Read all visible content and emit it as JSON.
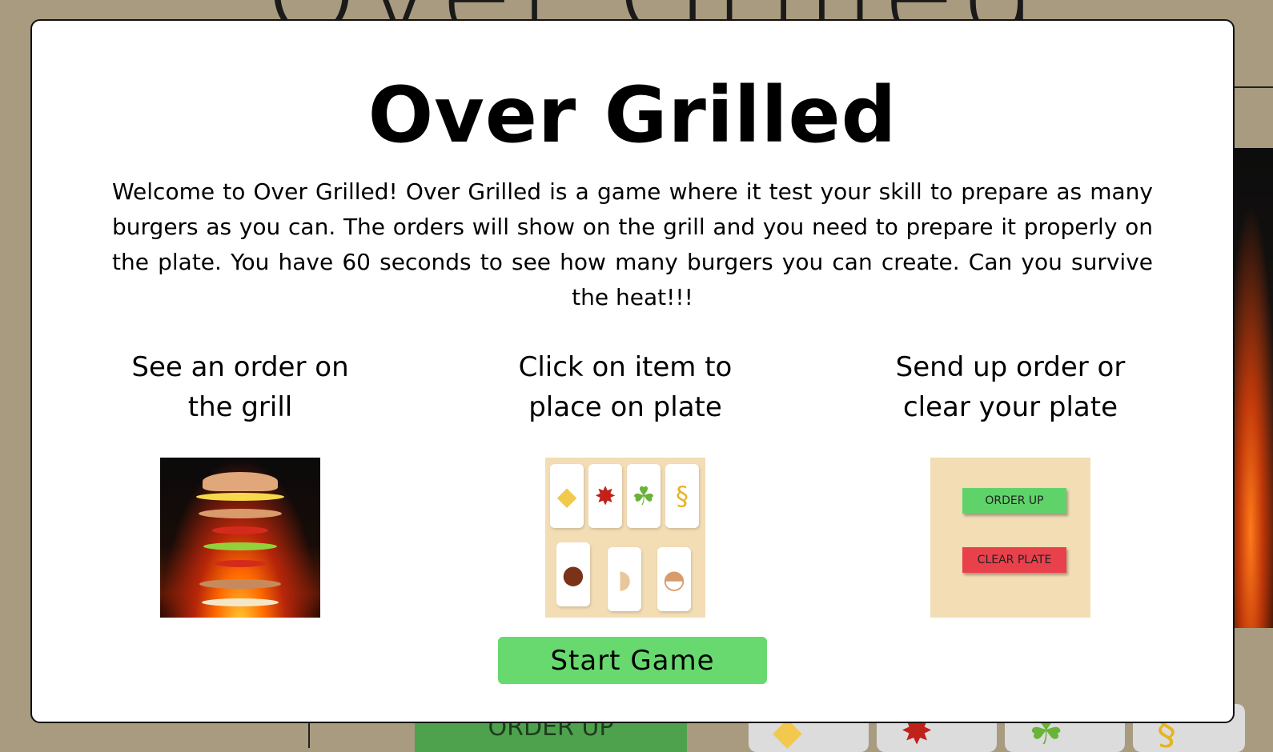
{
  "background": {
    "title_partial": "Over Grilled",
    "order_up_label": "ORDER UP",
    "tiles": [
      "cheese-icon",
      "ketchup-icon",
      "lettuce-icon",
      "mustard-icon"
    ]
  },
  "modal": {
    "title": "Over Grilled",
    "intro": "Welcome to Over Grilled! Over Grilled is a game where it test your skill to prepare as many burgers as you can. The orders will show on the grill and you need to prepare it properly on the plate. You have 60 seconds to see how many burgers you can create. Can you survive the heat!!!",
    "steps": [
      {
        "caption": "See an order on the grill",
        "image": "burger-order-on-grill"
      },
      {
        "caption": "Click on item to place on plate",
        "image": "ingredient-cards"
      },
      {
        "caption": "Send up order or clear your plate",
        "image": "order-buttons"
      }
    ],
    "example_buttons": {
      "order_up": "ORDER UP",
      "clear_plate": "CLEAR PLATE"
    },
    "start_button": "Start Game"
  },
  "colors": {
    "page_bg": "#a99b7f",
    "start_green": "#67d96f",
    "order_up_green": "#5fd36a",
    "clear_plate_red": "#e9414b",
    "tray_bg": "#f2ddb5"
  }
}
